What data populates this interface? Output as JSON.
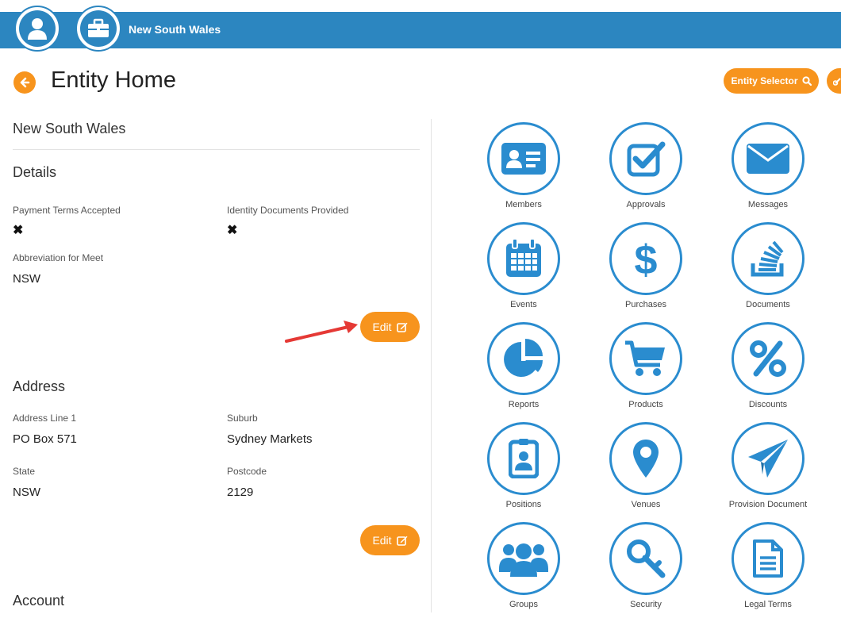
{
  "topbar": {
    "title": "New South Wales"
  },
  "header": {
    "page_title": "Entity Home",
    "entity_selector_label": "Entity Selector"
  },
  "entity_name": "New South Wales",
  "details": {
    "heading": "Details",
    "payment_terms_label": "Payment Terms Accepted",
    "payment_terms_value": "✖",
    "identity_docs_label": "Identity Documents Provided",
    "identity_docs_value": "✖",
    "abbreviation_label": "Abbreviation for Meet",
    "abbreviation_value": "NSW",
    "edit_label": "Edit"
  },
  "address": {
    "heading": "Address",
    "line1_label": "Address Line 1",
    "line1_value": "PO Box 571",
    "suburb_label": "Suburb",
    "suburb_value": "Sydney Markets",
    "state_label": "State",
    "state_value": "NSW",
    "postcode_label": "Postcode",
    "postcode_value": "2129",
    "edit_label": "Edit"
  },
  "account": {
    "heading": "Account"
  },
  "tiles": [
    {
      "label": "Members",
      "icon": "id-card-icon"
    },
    {
      "label": "Approvals",
      "icon": "checkbox-icon"
    },
    {
      "label": "Messages",
      "icon": "envelope-icon"
    },
    {
      "label": "Events",
      "icon": "calendar-icon"
    },
    {
      "label": "Purchases",
      "icon": "dollar-icon"
    },
    {
      "label": "Documents",
      "icon": "stack-icon"
    },
    {
      "label": "Reports",
      "icon": "pie-chart-icon"
    },
    {
      "label": "Products",
      "icon": "cart-icon"
    },
    {
      "label": "Discounts",
      "icon": "percent-icon"
    },
    {
      "label": "Positions",
      "icon": "badge-icon"
    },
    {
      "label": "Venues",
      "icon": "map-marker-icon"
    },
    {
      "label": "Provision Document",
      "icon": "paper-plane-icon"
    },
    {
      "label": "Groups",
      "icon": "users-icon"
    },
    {
      "label": "Security",
      "icon": "key-icon"
    },
    {
      "label": "Legal Terms",
      "icon": "file-text-icon"
    }
  ],
  "colors": {
    "brand_blue": "#2c86c0",
    "icon_blue": "#2a8ccf",
    "accent_orange": "#f7941d",
    "arrow_red": "#e53935"
  }
}
